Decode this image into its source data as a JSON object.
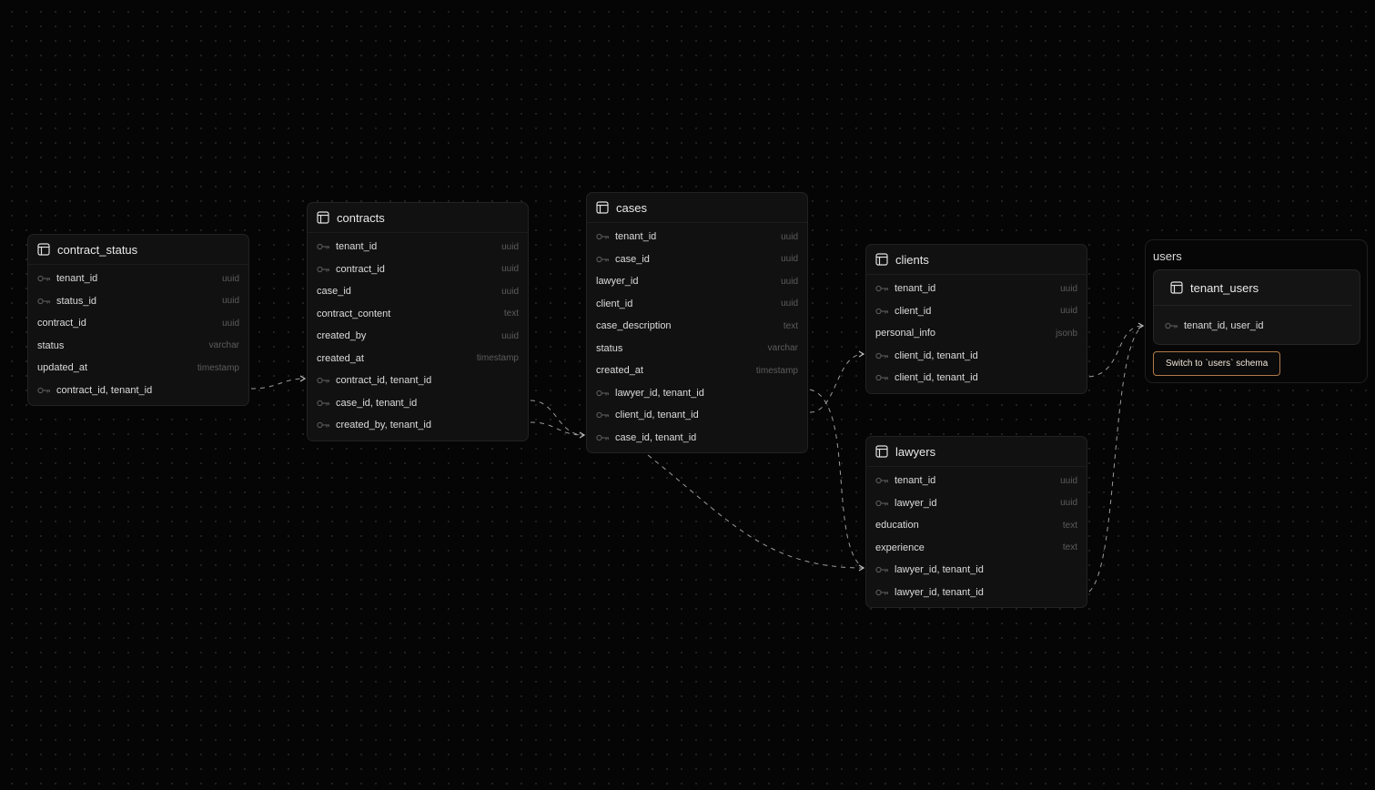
{
  "tables": [
    {
      "id": "contract_status",
      "name": "contract_status",
      "columns": [
        {
          "name": "tenant_id",
          "type": "uuid",
          "key": true
        },
        {
          "name": "status_id",
          "type": "uuid",
          "key": true
        },
        {
          "name": "contract_id",
          "type": "uuid",
          "key": false
        },
        {
          "name": "status",
          "type": "varchar",
          "key": false
        },
        {
          "name": "updated_at",
          "type": "timestamp",
          "key": false
        },
        {
          "name": "contract_id, tenant_id",
          "type": "",
          "key": true
        }
      ]
    },
    {
      "id": "contracts",
      "name": "contracts",
      "columns": [
        {
          "name": "tenant_id",
          "type": "uuid",
          "key": true
        },
        {
          "name": "contract_id",
          "type": "uuid",
          "key": true
        },
        {
          "name": "case_id",
          "type": "uuid",
          "key": false
        },
        {
          "name": "contract_content",
          "type": "text",
          "key": false
        },
        {
          "name": "created_by",
          "type": "uuid",
          "key": false
        },
        {
          "name": "created_at",
          "type": "timestamp",
          "key": false
        },
        {
          "name": "contract_id, tenant_id",
          "type": "",
          "key": true
        },
        {
          "name": "case_id, tenant_id",
          "type": "",
          "key": true
        },
        {
          "name": "created_by, tenant_id",
          "type": "",
          "key": true
        }
      ]
    },
    {
      "id": "cases",
      "name": "cases",
      "columns": [
        {
          "name": "tenant_id",
          "type": "uuid",
          "key": true
        },
        {
          "name": "case_id",
          "type": "uuid",
          "key": true
        },
        {
          "name": "lawyer_id",
          "type": "uuid",
          "key": false
        },
        {
          "name": "client_id",
          "type": "uuid",
          "key": false
        },
        {
          "name": "case_description",
          "type": "text",
          "key": false
        },
        {
          "name": "status",
          "type": "varchar",
          "key": false
        },
        {
          "name": "created_at",
          "type": "timestamp",
          "key": false
        },
        {
          "name": "lawyer_id, tenant_id",
          "type": "",
          "key": true
        },
        {
          "name": "client_id, tenant_id",
          "type": "",
          "key": true
        },
        {
          "name": "case_id, tenant_id",
          "type": "",
          "key": true
        }
      ]
    },
    {
      "id": "clients",
      "name": "clients",
      "columns": [
        {
          "name": "tenant_id",
          "type": "uuid",
          "key": true
        },
        {
          "name": "client_id",
          "type": "uuid",
          "key": true
        },
        {
          "name": "personal_info",
          "type": "jsonb",
          "key": false
        },
        {
          "name": "client_id, tenant_id",
          "type": "",
          "key": true
        },
        {
          "name": "client_id, tenant_id",
          "type": "",
          "key": true
        }
      ]
    },
    {
      "id": "lawyers",
      "name": "lawyers",
      "columns": [
        {
          "name": "tenant_id",
          "type": "uuid",
          "key": true
        },
        {
          "name": "lawyer_id",
          "type": "uuid",
          "key": true
        },
        {
          "name": "education",
          "type": "text",
          "key": false
        },
        {
          "name": "experience",
          "type": "text",
          "key": false
        },
        {
          "name": "lawyer_id, tenant_id",
          "type": "",
          "key": true
        },
        {
          "name": "lawyer_id, tenant_id",
          "type": "",
          "key": true
        }
      ]
    }
  ],
  "schema_group": {
    "title": "users",
    "table": {
      "name": "tenant_users",
      "columns": [
        {
          "name": "tenant_id, user_id",
          "type": "",
          "key": true
        }
      ]
    },
    "switch_button_label": "Switch to `users` schema"
  },
  "relationships": [
    {
      "from": "contract_status.contract_id, tenant_id",
      "to": "contracts.contract_id, tenant_id"
    },
    {
      "from": "contracts.case_id, tenant_id",
      "to": "cases.case_id, tenant_id"
    },
    {
      "from": "contracts.created_by, tenant_id",
      "to": "cases.case_id, tenant_id"
    },
    {
      "from": "cases.lawyer_id, tenant_id",
      "to": "lawyers.lawyer_id, tenant_id"
    },
    {
      "from": "cases.client_id, tenant_id",
      "to": "clients.client_id, tenant_id"
    },
    {
      "from": "cases.case_id, tenant_id",
      "to": "lawyers.lawyer_id, tenant_id"
    },
    {
      "from": "clients.client_id, tenant_id",
      "to": "users.tenant_users"
    },
    {
      "from": "lawyers.lawyer_id, tenant_id",
      "to": "users.tenant_users"
    }
  ],
  "colors": {
    "background": "#050505",
    "node": "#111111",
    "accent_button_border": "#b07a4a"
  }
}
